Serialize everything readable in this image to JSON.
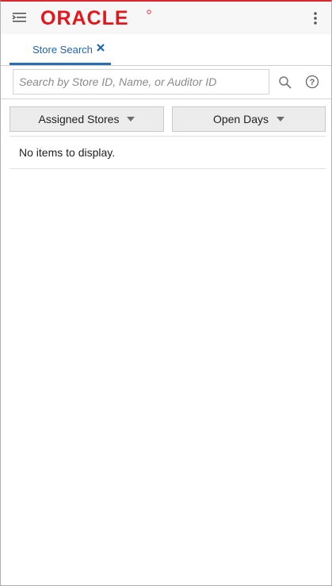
{
  "header": {
    "logo_text": "ORACLE",
    "brand_color": "#e3161c",
    "menu_icon": "navigation-drawer-icon",
    "more_icon": "vertical-ellipsis-icon"
  },
  "tabs": [
    {
      "label": "Store Search",
      "active": true,
      "close_icon": "close-icon"
    }
  ],
  "search": {
    "value": "",
    "placeholder": "Search by Store ID, Name, or Auditor ID",
    "search_icon": "search-icon",
    "help_icon": "help-icon"
  },
  "filters": [
    {
      "label": "Assigned Stores",
      "icon": "caret-down-icon"
    },
    {
      "label": "Open Days",
      "icon": "caret-down-icon"
    }
  ],
  "results": {
    "empty_message": "No items to display."
  },
  "colors": {
    "accent": "#2a6db1",
    "top_border": "#d8262d"
  }
}
